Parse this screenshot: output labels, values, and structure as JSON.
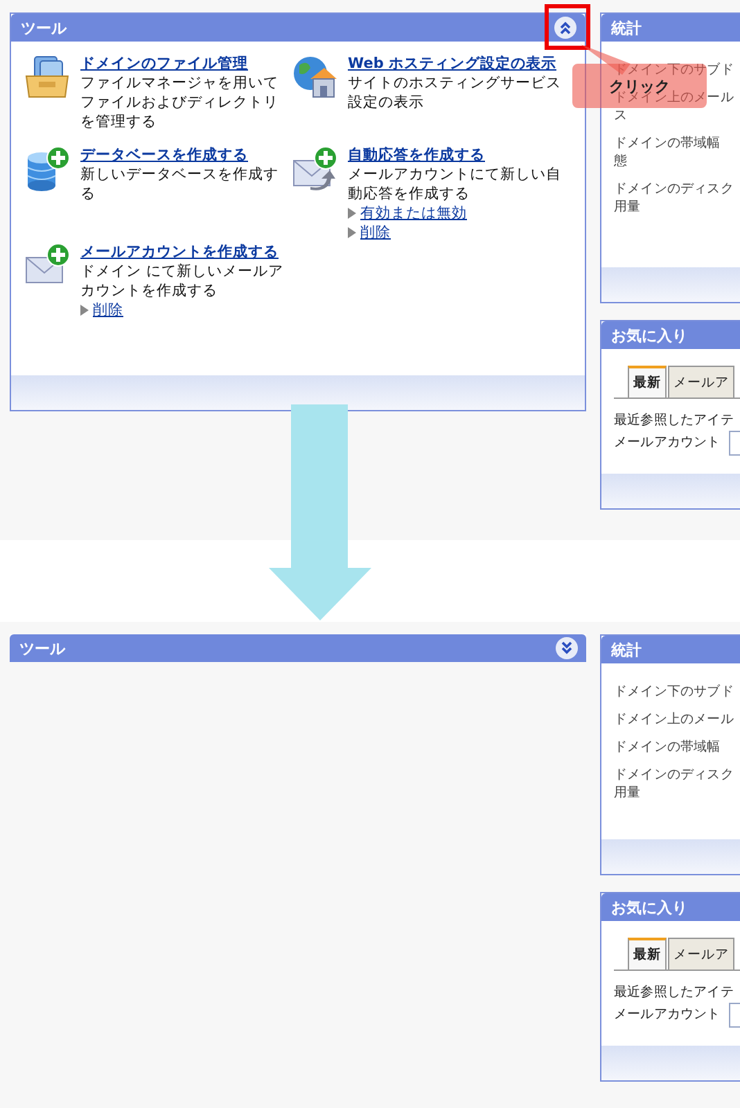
{
  "steps": [
    {
      "tools_panel": {
        "title": "ツール",
        "expanded": true,
        "items": [
          {
            "kind": "files",
            "title": "ドメインのファイル管理",
            "description": "ファイルマネージャを用いてファイルおよびディレクトリを管理する"
          },
          {
            "kind": "hosting",
            "title": "Web ホスティング設定の表示",
            "description": "サイトのホスティングサービス設定の表示"
          },
          {
            "kind": "database",
            "title": "データベースを作成する",
            "description": "新しいデータベースを作成する"
          },
          {
            "kind": "autoreply",
            "title": "自動応答を作成する",
            "description": "メールアカウントにて新しい自動応答を作成する",
            "links": [
              "有効または無効",
              "削除"
            ]
          },
          {
            "kind": "mail",
            "title": "メールアカウントを作成する",
            "description": "ドメイン にて新しいメールアカウントを作成する",
            "links": [
              "削除"
            ]
          }
        ]
      },
      "stats_panel": {
        "title": "統計",
        "items": [
          {
            "lines": [
              "ドメイン下のサブド"
            ]
          },
          {
            "lines": [
              "ドメイン上のメール",
              "ス"
            ]
          },
          {
            "lines": [
              "ドメインの帯域幅",
              "態"
            ]
          },
          {
            "lines": [
              "ドメインのディスク",
              "用量"
            ]
          }
        ]
      },
      "favorites_panel": {
        "title": "お気に入り",
        "tabs": [
          {
            "label": "最新",
            "selected": true
          },
          {
            "label": "メールア",
            "selected": false
          }
        ],
        "recent_label": "最近参照したアイテ",
        "item_label": "メールアカウント"
      },
      "callout": {
        "text": "クリック"
      }
    },
    {
      "tools_panel": {
        "title": "ツール",
        "expanded": false
      },
      "stats_panel": {
        "title": "統計",
        "items": [
          {
            "lines": [
              "ドメイン下のサブド"
            ]
          },
          {
            "lines": [
              "ドメイン上のメール"
            ]
          },
          {
            "lines": [
              "ドメインの帯域幅"
            ]
          },
          {
            "lines": [
              "ドメインのディスク",
              "用量"
            ]
          }
        ]
      },
      "favorites_panel": {
        "title": "お気に入り",
        "tabs": [
          {
            "label": "最新",
            "selected": true
          },
          {
            "label": "メールア",
            "selected": false
          }
        ],
        "recent_label": "最近参照したアイテ",
        "item_label": "メールアカウント"
      }
    }
  ]
}
